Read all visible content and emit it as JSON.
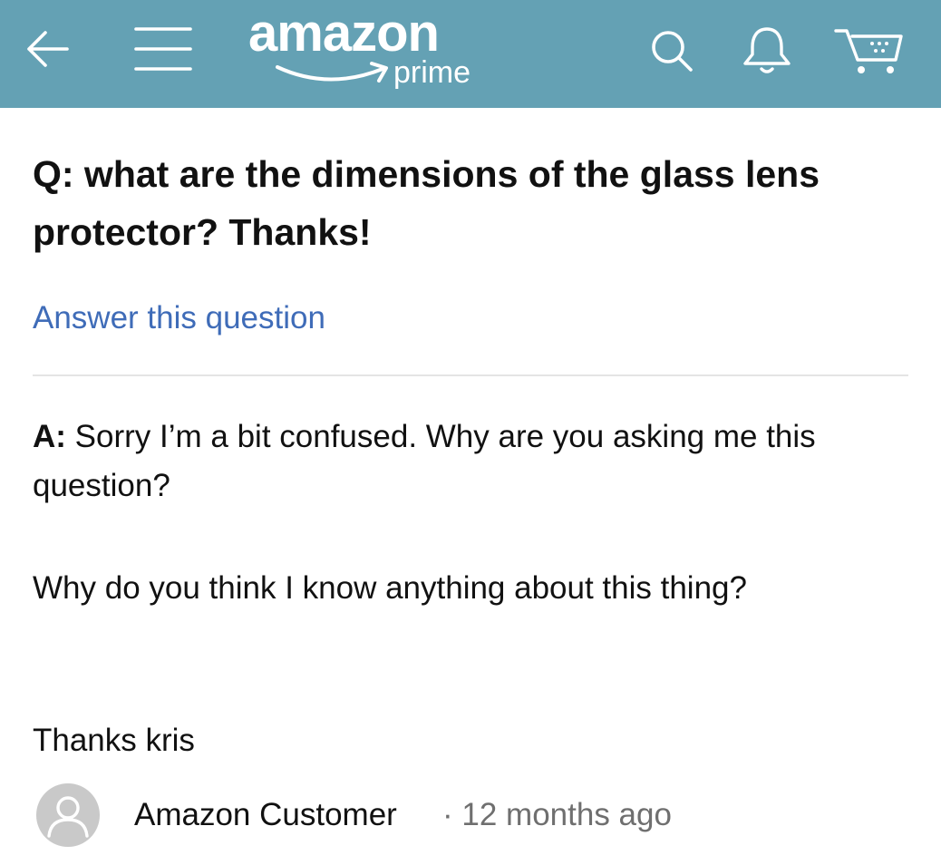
{
  "header": {
    "logo_text": "amazon",
    "logo_sub": "prime",
    "background_color": "#64a1b4",
    "icons": [
      "back-arrow-icon",
      "menu-icon",
      "search-icon",
      "bell-icon",
      "cart-icon"
    ]
  },
  "question": {
    "text": "Q: what are the dimensions of the glass lens protector? Thanks!"
  },
  "answer_link": {
    "label": "Answer this question",
    "color": "#3f6cb8"
  },
  "answer": {
    "prefix": "A:",
    "paragraphs": [
      "Sorry I’m a bit confused. Why are you asking me this question?",
      "Why do you think I know anything about this thing?",
      "Thanks kris"
    ]
  },
  "author": {
    "name": "Amazon Customer",
    "separator": "·",
    "time": "12 months ago",
    "avatar_icon": "user-avatar-icon"
  }
}
